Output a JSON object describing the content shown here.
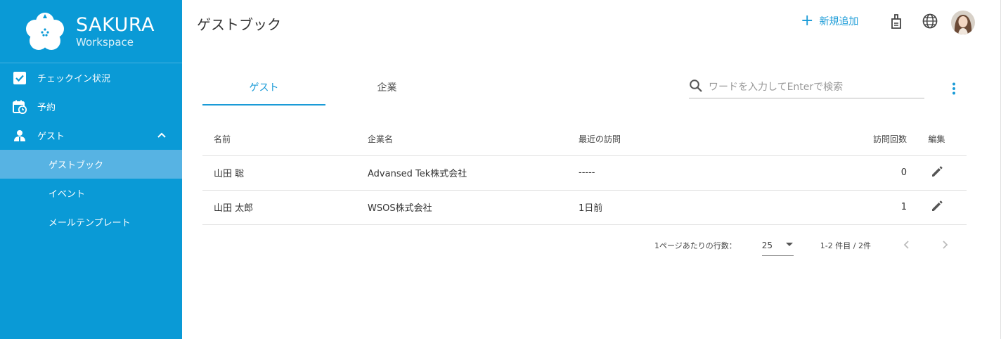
{
  "brand": {
    "name": "SAKURA",
    "sub": "Workspace"
  },
  "nav": {
    "checkin": "チェックイン状況",
    "reservation": "予約",
    "guest": "ゲスト",
    "sub": {
      "guestbook": "ゲストブック",
      "event": "イベント",
      "mail_template": "メールテンプレート"
    }
  },
  "header": {
    "title": "ゲストブック",
    "add_label": "新規追加"
  },
  "tabs": {
    "guest": "ゲスト",
    "company": "企業"
  },
  "search": {
    "placeholder": "ワードを入力してEnterで検索",
    "value": ""
  },
  "table": {
    "headers": {
      "name": "名前",
      "company": "企業名",
      "recent": "最近の訪問",
      "count": "訪問回数",
      "edit": "編集"
    },
    "rows": [
      {
        "name": "山田 聡",
        "company": "Advansed Tek株式会社",
        "recent": "-----",
        "count": "0"
      },
      {
        "name": "山田 太郎",
        "company": "WSOS株式会社",
        "recent": "1日前",
        "count": "1"
      }
    ]
  },
  "pagination": {
    "rows_label": "1ページあたりの行数：",
    "rows_value": "25",
    "range": "1-2 件目 / 2件"
  },
  "colors": {
    "sidebar": "#0a9ad6",
    "active_item": "#57b3e3",
    "accent": "#1a9bd7"
  },
  "icons": [
    "checkbox-icon",
    "calendar-clock-icon",
    "guest-icon",
    "chevron-up-icon",
    "plus-icon",
    "visitor-badge-icon",
    "globe-icon",
    "search-icon",
    "more-vert-icon",
    "pencil-icon",
    "dropdown-arrow-icon",
    "chevron-left-icon",
    "chevron-right-icon"
  ]
}
